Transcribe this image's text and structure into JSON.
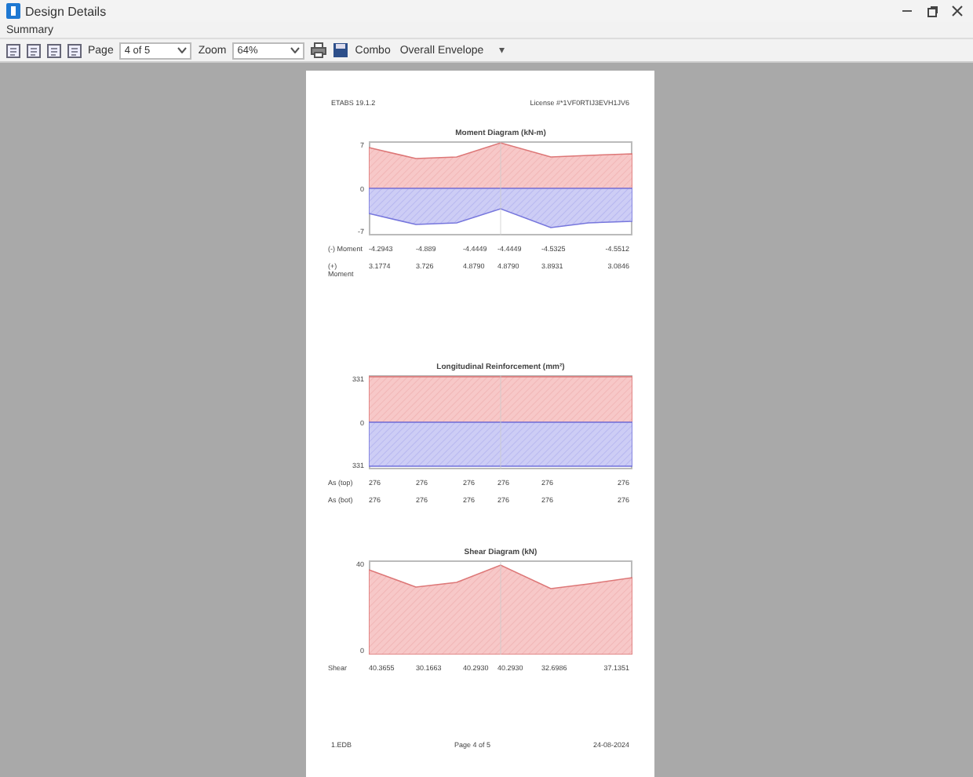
{
  "window": {
    "title": "Design Details"
  },
  "menu": [
    "Summary"
  ],
  "toolbar": {
    "page_label": "Page",
    "page_value": "4 of 5",
    "zoom_label": "Zoom",
    "zoom_value": "64%",
    "combo_label": "Combo",
    "combo_value": "Overall Envelope",
    "combo_caret": "▾"
  },
  "document": {
    "header_left": "ETABS 19.1.2",
    "header_right": "License #*1VF0RTIJ3EVH1JV6",
    "sections": [
      {
        "kind": "moment",
        "title": "Moment Diagram (kN-m)",
        "ticks": [
          "7",
          "0",
          "-7"
        ],
        "rows": [
          {
            "label": "(-) Moment",
            "values": [
              "-4.2943",
              "-4.889",
              "-4.4449",
              "-4.4449",
              "-4.5325",
              "-4.5512"
            ]
          },
          {
            "label": "(+) Moment",
            "values": [
              "3.1774",
              "3.726",
              "4.8790",
              "4.8790",
              "3.8931",
              "3.0846"
            ]
          }
        ]
      },
      {
        "kind": "reinforcement",
        "title": "Longitudinal Reinforcement (mm²)",
        "ticks": [
          "331",
          "0",
          "331"
        ],
        "rows": [
          {
            "label": "As (top)",
            "values": [
              "276",
              "276",
              "276",
              "276",
              "276",
              "276"
            ]
          },
          {
            "label": "As (bot)",
            "values": [
              "276",
              "276",
              "276",
              "276",
              "276",
              "276"
            ]
          }
        ]
      },
      {
        "kind": "shear",
        "title": "Shear Diagram (kN)",
        "ticks": [
          "40",
          "0"
        ],
        "rows": [
          {
            "label": "Shear",
            "values": [
              "40.3655",
              "30.1663",
              "40.2930",
              "40.2930",
              "32.6986",
              "37.1351"
            ]
          }
        ]
      }
    ],
    "footer_left": "1.EDB",
    "footer_center": "Page 4 of 5",
    "footer_right": "24-08-2024"
  }
}
